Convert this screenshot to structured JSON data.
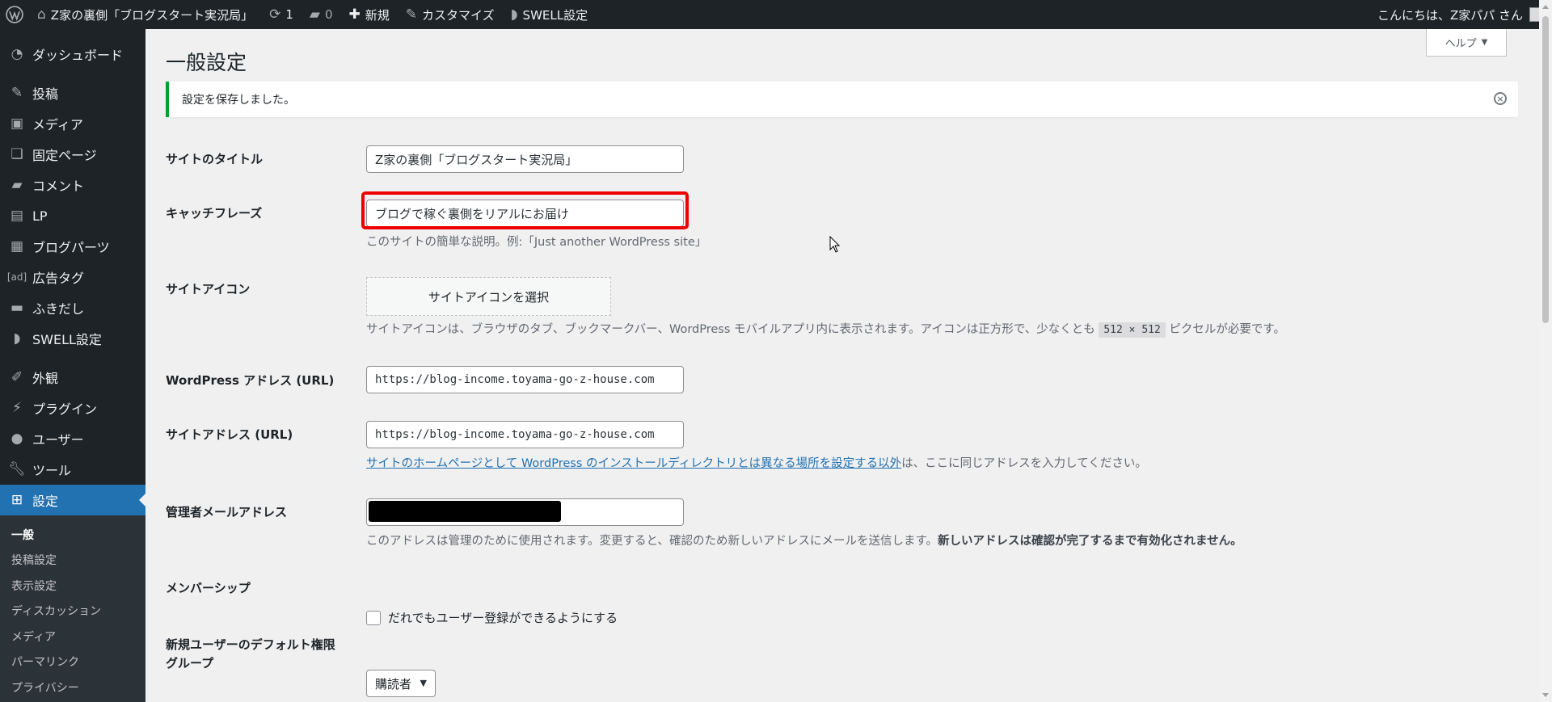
{
  "adminbar": {
    "site_name": "Z家の裏側「ブログスタート実況局」",
    "updates_count": "1",
    "comments_count": "0",
    "new_label": "新規",
    "customize_label": "カスタマイズ",
    "swell_label": "SWELL設定",
    "greeting": "こんにちは、Z家パパ さん"
  },
  "sidebar": {
    "items": [
      {
        "label": "ダッシュボード",
        "icon": "dashboard-icon"
      },
      {
        "label": "投稿",
        "icon": "pin-icon"
      },
      {
        "label": "メディア",
        "icon": "media-icon"
      },
      {
        "label": "固定ページ",
        "icon": "page-icon"
      },
      {
        "label": "コメント",
        "icon": "comment-icon"
      },
      {
        "label": "LP",
        "icon": "document-icon"
      },
      {
        "label": "ブログパーツ",
        "icon": "grid-icon"
      },
      {
        "label": "広告タグ",
        "icon": "ad-icon"
      },
      {
        "label": "ふきだし",
        "icon": "bubble-icon"
      },
      {
        "label": "SWELL設定",
        "icon": "swell-icon"
      },
      {
        "label": "外観",
        "icon": "brush-icon"
      },
      {
        "label": "プラグイン",
        "icon": "plugin-icon"
      },
      {
        "label": "ユーザー",
        "icon": "user-icon"
      },
      {
        "label": "ツール",
        "icon": "wrench-icon"
      },
      {
        "label": "設定",
        "icon": "settings-icon"
      }
    ],
    "submenu": [
      "一般",
      "投稿設定",
      "表示設定",
      "ディスカッション",
      "メディア",
      "パーマリンク",
      "プライバシー"
    ]
  },
  "content": {
    "help_label": "ヘルプ",
    "page_title": "一般設定",
    "notice": "設定を保存しました。",
    "site_title_label": "サイトのタイトル",
    "site_title_value": "Z家の裏側「ブログスタート実況局」",
    "tagline_label": "キャッチフレーズ",
    "tagline_value": "ブログで稼ぐ裏側をリアルにお届け",
    "tagline_desc": "このサイトの簡単な説明。例:「Just another WordPress site」",
    "site_icon_label": "サイトアイコン",
    "site_icon_button": "サイトアイコンを選択",
    "site_icon_desc_before": "サイトアイコンは、ブラウザのタブ、ブックマークバー、WordPress モバイルアプリ内に表示されます。アイコンは正方形で、少なくとも ",
    "site_icon_size": "512 × 512",
    "site_icon_desc_after": " ピクセルが必要です。",
    "wp_address_label": "WordPress アドレス (URL)",
    "wp_address_value": "https://blog-income.toyama-go-z-house.com",
    "site_address_label": "サイトアドレス (URL)",
    "site_address_value": "https://blog-income.toyama-go-z-house.com",
    "site_address_link": "サイトのホームページとして WordPress のインストールディレクトリとは異なる場所を設定する以外",
    "site_address_desc_after": "は、ここに同じアドレスを入力してください。",
    "admin_email_label": "管理者メールアドレス",
    "admin_email_desc": "このアドレスは管理のために使用されます。変更すると、確認のため新しいアドレスにメールを送信します。",
    "admin_email_desc_bold": "新しいアドレスは確認が完了するまで有効化されません。",
    "membership_label": "メンバーシップ",
    "membership_checkbox": "だれでもユーザー登録ができるようにする",
    "default_role_label_1": "新規ユーザーのデフォルト権限",
    "default_role_label_2": "グループ",
    "default_role_value": "購読者"
  }
}
